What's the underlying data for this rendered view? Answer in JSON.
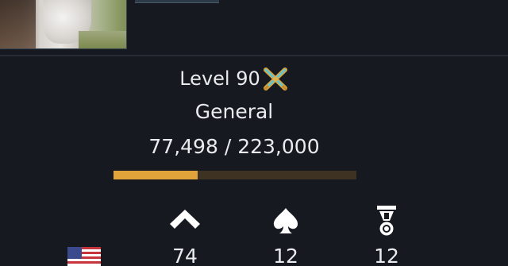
{
  "profile": {
    "level_label": "Level 90",
    "rank_name": "General",
    "xp_current": "77,498",
    "xp_separator": "/",
    "xp_total": "223,000",
    "xp_progress": 0.3475,
    "country_flag": "us-flag",
    "avatar_icon": "player-avatar",
    "rank_icon": "crossed-swords-rank-icon"
  },
  "stats": [
    {
      "icon": "chevron-up-icon",
      "value": "74"
    },
    {
      "icon": "spade-icon",
      "value": "12"
    },
    {
      "icon": "medal-icon",
      "value": "12"
    }
  ],
  "colors": {
    "background": "#161920",
    "xp_fill": "#e1a43a",
    "xp_track": "#3e3223",
    "text": "#e9ebee"
  }
}
